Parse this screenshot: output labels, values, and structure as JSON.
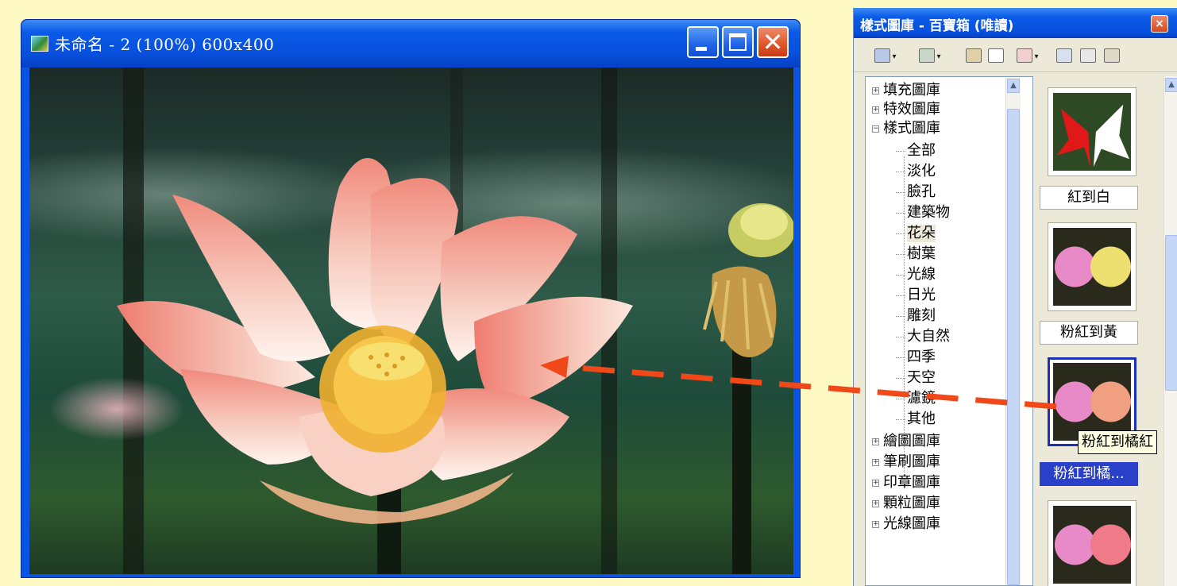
{
  "image_window": {
    "title": "未命名 - 2 (100%) 600x400",
    "controls": {
      "minimize": "minimize",
      "maximize": "maximize",
      "close": "close"
    }
  },
  "gallery_panel": {
    "title": "樣式圖庫 - 百寶箱 (唯讀)",
    "close_glyph": "×",
    "toolbar_icons": [
      "gallery-view-icon",
      "open-gallery-icon",
      "gallery-manager-icon",
      "tree-view-icon",
      "tool-icon",
      "thumbnail-grid-icon",
      "details-icon",
      "misc-icon"
    ],
    "tree": {
      "top_items": [
        {
          "label": "填充圖庫",
          "expander": "+"
        },
        {
          "label": "特效圖庫",
          "expander": "+"
        },
        {
          "label": "樣式圖庫",
          "expander": "−"
        }
      ],
      "children": [
        "全部",
        "淡化",
        "臉孔",
        "建築物",
        "花朵",
        "樹葉",
        "光線",
        "日光",
        "雕刻",
        "大自然",
        "四季",
        "天空",
        "濾鏡",
        "其他"
      ],
      "selected_child": "花朵",
      "bottom_items": [
        {
          "label": "繪圖圖庫",
          "expander": "+"
        },
        {
          "label": "筆刷圖庫",
          "expander": "+"
        },
        {
          "label": "印章圖庫",
          "expander": "+"
        },
        {
          "label": "顆粒圖庫",
          "expander": "+"
        },
        {
          "label": "光線圖庫",
          "expander": "+"
        }
      ]
    },
    "thumbnails": [
      {
        "label": "紅到白",
        "selected": false
      },
      {
        "label": "粉紅到黃",
        "selected": false
      },
      {
        "label": "粉紅到橘...",
        "selected": true
      },
      {
        "label": "",
        "selected": false
      }
    ],
    "tooltip": "粉紅到橘紅"
  }
}
